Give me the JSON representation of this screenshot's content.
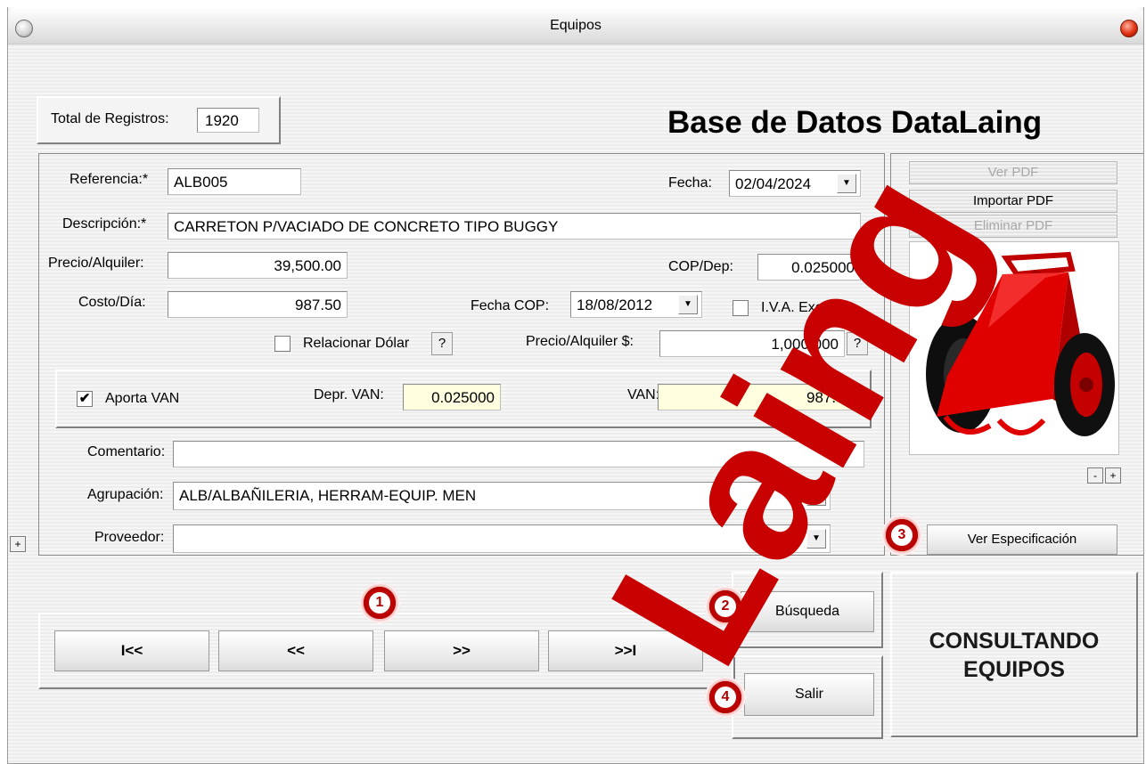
{
  "window": {
    "title": "Equipos"
  },
  "header": {
    "total_label": "Total de Registros:",
    "total_value": "1920",
    "app_title": "Base de Datos DataLaing"
  },
  "form": {
    "referencia_label": "Referencia:*",
    "referencia_value": "ALB005",
    "fecha_label": "Fecha:",
    "fecha_value": "02/04/2024",
    "descripcion_label": "Descripción:*",
    "descripcion_value": "CARRETON P/VACIADO DE CONCRETO TIPO BUGGY",
    "precio_label": "Precio/Alquiler:",
    "precio_value": "39,500.00",
    "copdep_label": "COP/Dep:",
    "copdep_value": "0.025000",
    "costo_label": "Costo/Día:",
    "costo_value": "987.50",
    "fechacop_label": "Fecha COP:",
    "fechacop_value": "18/08/2012",
    "iva_label": "I.V.A. Exento",
    "iva_checked": false,
    "dolar_label": "Relacionar Dólar",
    "dolar_checked": false,
    "help_label": "?",
    "precio_usd_label": "Precio/Alquiler $:",
    "precio_usd_value": "1,000.000",
    "aporta_label": "Aporta VAN",
    "aporta_checked": true,
    "aporta_mark": "✔",
    "deprvan_label": "Depr. VAN:",
    "deprvan_value": "0.025000",
    "van_label": "VAN:",
    "van_value": "987.50",
    "comentario_label": "Comentario:",
    "comentario_value": "",
    "agrupacion_label": "Agrupación:",
    "agrupacion_value": "ALB/ALBAÑILERIA, HERRAM-EQUIP. MEN",
    "proveedor_label": "Proveedor:",
    "proveedor_value": "",
    "expand_label": "+"
  },
  "pdf_panel": {
    "ver_pdf": "Ver PDF",
    "importar_pdf": "Importar PDF",
    "eliminar_pdf": "Eliminar PDF",
    "zoom_out": "-",
    "zoom_in": "+",
    "ver_especificacion": "Ver Especificación"
  },
  "navigation": {
    "first": "I<<",
    "prev": "<<",
    "next": ">>",
    "last": ">>I",
    "busqueda": "Búsqueda",
    "salir": "Salir"
  },
  "status": {
    "line1": "CONSULTANDO",
    "line2": "EQUIPOS"
  },
  "badges": [
    "1",
    "2",
    "3",
    "4"
  ],
  "watermark": "Laing",
  "colors": {
    "accent_red": "#b50000",
    "highlight_yellow": "#ffffe0",
    "cart_red": "#e00000"
  }
}
